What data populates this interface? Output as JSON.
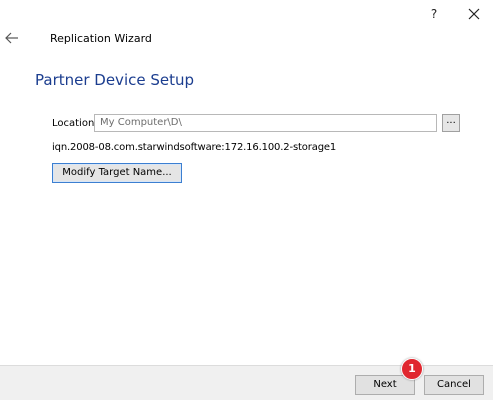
{
  "window": {
    "help_label": "?",
    "close_icon": "close-icon",
    "back_icon": "back-arrow-icon"
  },
  "wizard": {
    "title": "Replication Wizard",
    "section_title": "Partner Device Setup"
  },
  "location": {
    "label": "Location:",
    "value": "My Computer\\D\\",
    "browse_label": "..."
  },
  "target": {
    "iqn": "iqn.2008-08.com.starwindsoftware:172.16.100.2-storage1",
    "modify_label": "Modify Target Name..."
  },
  "footer": {
    "next_label": "Next",
    "cancel_label": "Cancel"
  },
  "annotation": {
    "step_number": "1",
    "color": "#e0272f"
  },
  "colors": {
    "section_title": "#1b3d8f",
    "footer_bg": "#f0f0f0"
  }
}
